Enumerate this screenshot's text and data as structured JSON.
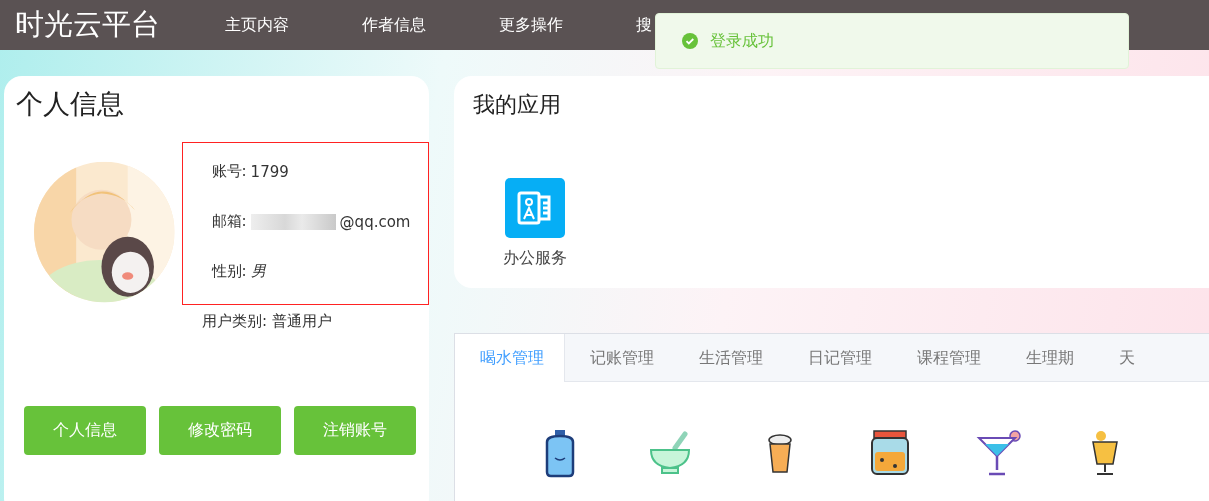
{
  "header": {
    "logo": "时光云平台",
    "nav": [
      {
        "label": "主页内容"
      },
      {
        "label": "作者信息"
      },
      {
        "label": "更多操作"
      },
      {
        "label": "搜"
      }
    ]
  },
  "toast": {
    "kind": "success",
    "message": "登录成功"
  },
  "profile": {
    "title": "个人信息",
    "avatar": {
      "kind": "picture"
    },
    "fields": [
      {
        "label": "账号:",
        "value": "1799",
        "italic": false,
        "redacted": false
      },
      {
        "label": "邮箱:",
        "value": "@qq.com",
        "italic": false,
        "redacted": true
      },
      {
        "label": "性别:",
        "value": "男",
        "italic": true,
        "redacted": false
      }
    ],
    "extra": {
      "label": "用户类别:",
      "value": "普通用户"
    },
    "buttons": [
      "个人信息",
      "修改密码",
      "注销账号"
    ]
  },
  "apps": {
    "title": "我的应用",
    "items": [
      {
        "label": "办公服务"
      }
    ]
  },
  "tabs": [
    {
      "label": "喝水管理",
      "selected": true
    },
    {
      "label": "记账管理",
      "selected": false
    },
    {
      "label": "生活管理",
      "selected": false
    },
    {
      "label": "日记管理",
      "selected": false
    },
    {
      "label": "课程管理",
      "selected": false
    },
    {
      "label": "生理期",
      "selected": false
    },
    {
      "label": "天",
      "selected": false
    }
  ],
  "drinks": [
    {
      "kind": "bottle"
    },
    {
      "kind": "bowl"
    },
    {
      "kind": "cup"
    },
    {
      "kind": "jar"
    },
    {
      "kind": "cocktail"
    },
    {
      "kind": "juice"
    }
  ]
}
